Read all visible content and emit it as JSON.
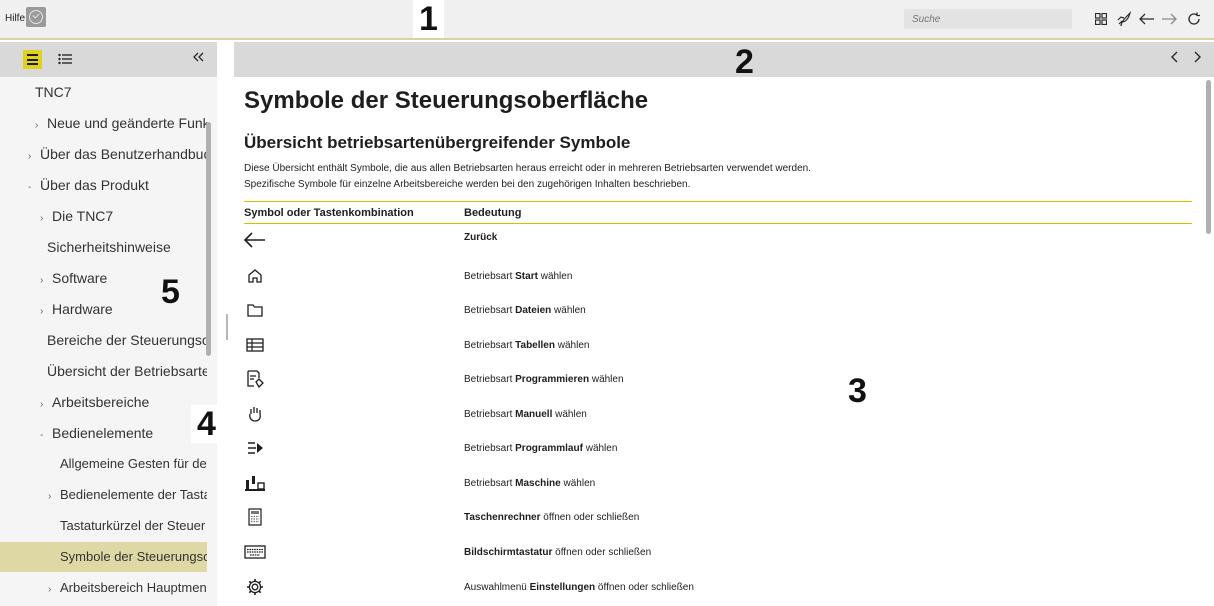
{
  "topbar": {
    "help_label": "Hilfe",
    "search_placeholder": "Suche",
    "icons": [
      "check-circle-icon",
      "grid-icon",
      "rocket-icon",
      "arrow-left-icon",
      "arrow-right-icon",
      "reload-icon"
    ]
  },
  "callouts": [
    "1",
    "2",
    "3",
    "4",
    "5"
  ],
  "sidebar": {
    "items": [
      {
        "label": "TNC7",
        "arrow": ""
      },
      {
        "label": "Neue und geänderte Funkti",
        "arrow": "›"
      },
      {
        "label": "Über das Benutzerhandbuc",
        "arrow": "›"
      },
      {
        "label": "Über das Produkt",
        "arrow": "-"
      },
      {
        "label": "Die TNC7",
        "arrow": "›"
      },
      {
        "label": "Sicherheitshinweise",
        "arrow": ""
      },
      {
        "label": "Software",
        "arrow": "›"
      },
      {
        "label": "Hardware",
        "arrow": "›"
      },
      {
        "label": "Bereiche der Steuerungso",
        "arrow": ""
      },
      {
        "label": "Übersicht der Betriebsarte",
        "arrow": ""
      },
      {
        "label": "Arbeitsbereiche",
        "arrow": "›"
      },
      {
        "label": "Bedienelemente",
        "arrow": "-"
      },
      {
        "label": "Allgemeine Gesten für der",
        "arrow": ""
      },
      {
        "label": "Bedienelemente der Tasta",
        "arrow": "›"
      },
      {
        "label": "Tastaturkürzel der Steuer",
        "arrow": ""
      },
      {
        "label": "Symbole der Steuerungso",
        "arrow": ""
      },
      {
        "label": "Arbeitsbereich Hauptmen",
        "arrow": "›"
      }
    ],
    "active_item": "Symbole der Steuerungso"
  },
  "content": {
    "page_title": "Symbole der Steuerungsoberfläche",
    "section_title": "Übersicht betriebsartenübergreifender Symbole",
    "intro_line1": "Diese Übersicht enthält Symbole, die aus allen Betriebsarten heraus erreicht oder in mehreren Betriebsarten verwendet werden.",
    "intro_line2": "Spezifische Symbole für einzelne Arbeitsbereiche werden bei den zugehörigen Inhalten beschrieben.",
    "table_headers": [
      "Symbol oder Tastenkombination",
      "Bedeutung"
    ],
    "rows": [
      {
        "icon": "arrow-left-icon",
        "pre": "",
        "bold": "Zurück",
        "post": ""
      },
      {
        "icon": "home-icon",
        "pre": "Betriebsart ",
        "bold": "Start",
        "post": " wählen"
      },
      {
        "icon": "folder-icon",
        "pre": "Betriebsart ",
        "bold": "Dateien",
        "post": " wählen"
      },
      {
        "icon": "table-icon",
        "pre": "Betriebsart ",
        "bold": "Tabellen",
        "post": " wählen"
      },
      {
        "icon": "program-edit-icon",
        "pre": "Betriebsart ",
        "bold": "Programmieren",
        "post": " wählen"
      },
      {
        "icon": "hand-icon",
        "pre": "Betriebsart ",
        "bold": "Manuell",
        "post": " wählen"
      },
      {
        "icon": "program-run-icon",
        "pre": "Betriebsart ",
        "bold": "Programmlauf",
        "post": " wählen"
      },
      {
        "icon": "machine-icon",
        "pre": "Betriebsart ",
        "bold": "Maschine",
        "post": " wählen"
      },
      {
        "icon": "calculator-icon",
        "pre": "",
        "bold": "Taschenrechner",
        "post": " öffnen oder schließen"
      },
      {
        "icon": "keyboard-icon",
        "pre": "",
        "bold": "Bildschirmtastatur",
        "post": " öffnen oder schließen"
      },
      {
        "icon": "gear-icon",
        "pre": "Auswahlmenü ",
        "bold": "Einstellungen",
        "post": " öffnen oder schließen"
      }
    ]
  },
  "colors": {
    "accent": "#e0d21c",
    "active_nav": "#ddd8a4",
    "table_line": "#d3c400",
    "topbar_bg": "#f0f0f0",
    "header_bar": "#d9d9d9"
  }
}
